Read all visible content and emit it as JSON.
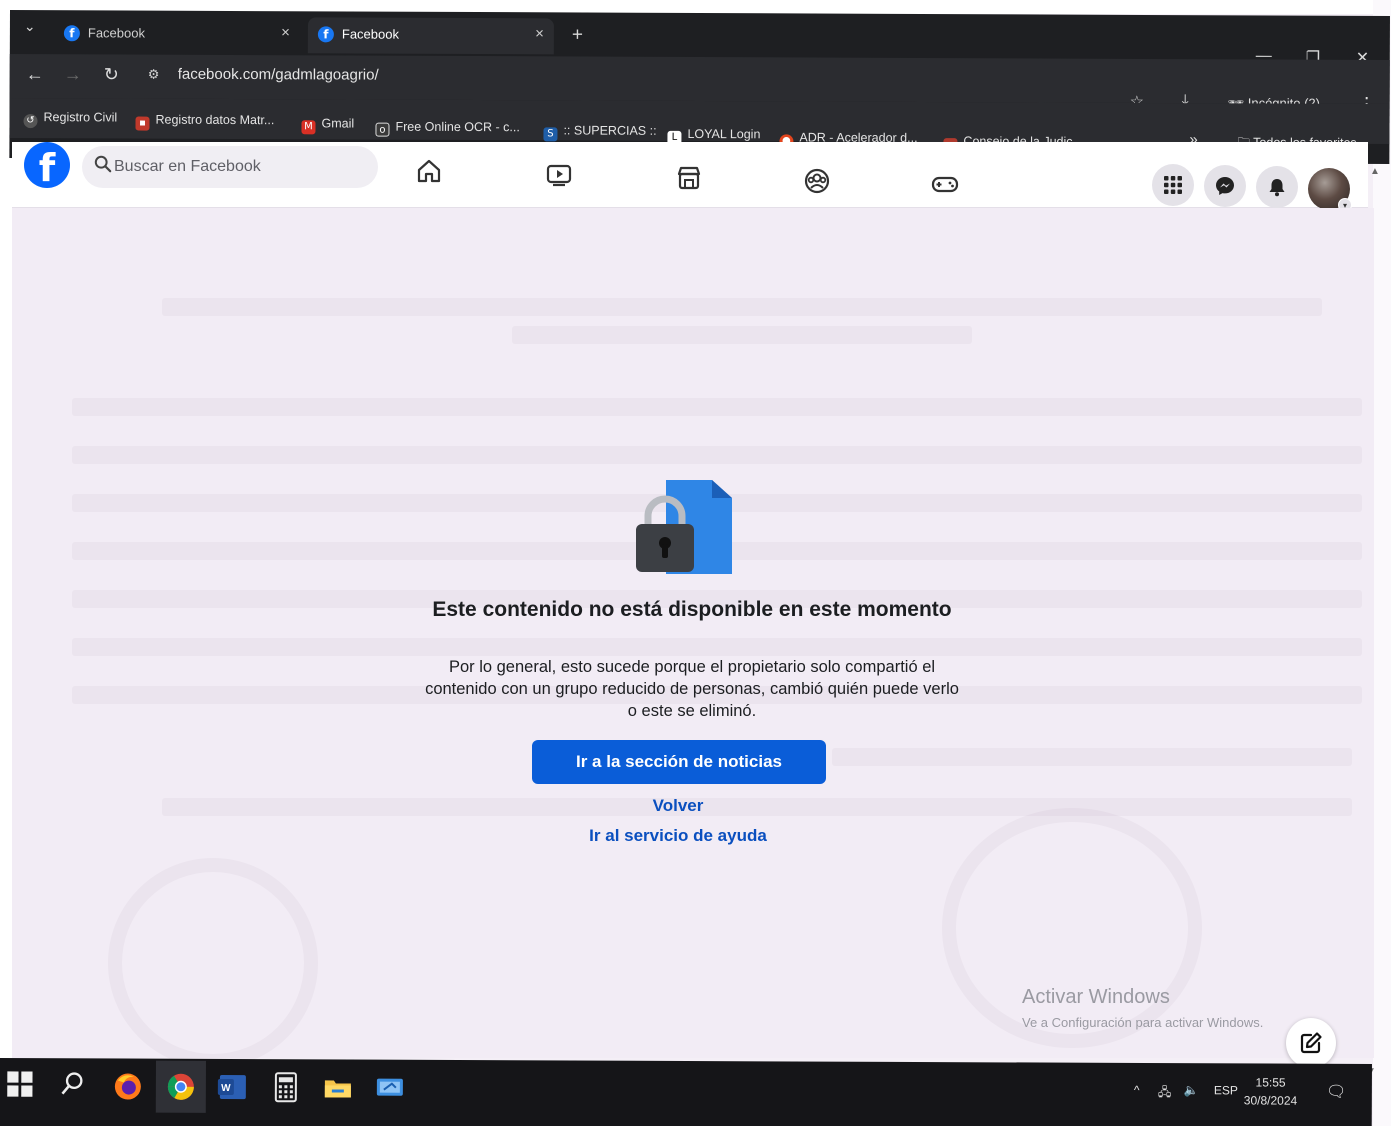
{
  "browser": {
    "tabs": [
      {
        "title": "Facebook",
        "active": false
      },
      {
        "title": "Facebook",
        "active": true
      }
    ],
    "url": "facebook.com/gadmlagoagrio/",
    "incognito_label": "Incógnito (2)",
    "bookmarks": [
      {
        "label": "Registro Civil",
        "icon": "registro-civil-icon"
      },
      {
        "label": "Registro datos Matr...",
        "icon": "registro-datos-icon"
      },
      {
        "label": "Gmail",
        "icon": "gmail-icon"
      },
      {
        "label": "Free Online OCR - c...",
        "icon": "ocr-icon"
      },
      {
        "label": ":: SUPERCIAS ::",
        "icon": "supercias-icon"
      },
      {
        "label": "LOYAL Login",
        "icon": "loyal-icon"
      },
      {
        "label": "ADR - Acelerador d...",
        "icon": "adr-icon"
      },
      {
        "label": "Consejo de la Judic...",
        "icon": "consejo-icon"
      }
    ],
    "all_bookmarks_label": "Todos los favoritos"
  },
  "facebook": {
    "search_placeholder": "Buscar en Facebook",
    "brand_color": "#0866ff"
  },
  "message": {
    "title": "Este contenido no está disponible en este momento",
    "body": "Por lo general, esto sucede porque el propietario solo compartió el contenido con un grupo reducido de personas, cambió quién puede verlo o este se eliminó.",
    "primary_button": "Ir a la sección de noticias",
    "back_link": "Volver",
    "help_link": "Ir al servicio de ayuda"
  },
  "watermark": {
    "line1": "Activar Windows",
    "line2": "Ve a Configuración para activar Windows."
  },
  "taskbar": {
    "language": "ESP",
    "time": "15:55",
    "date": "30/8/2024"
  }
}
